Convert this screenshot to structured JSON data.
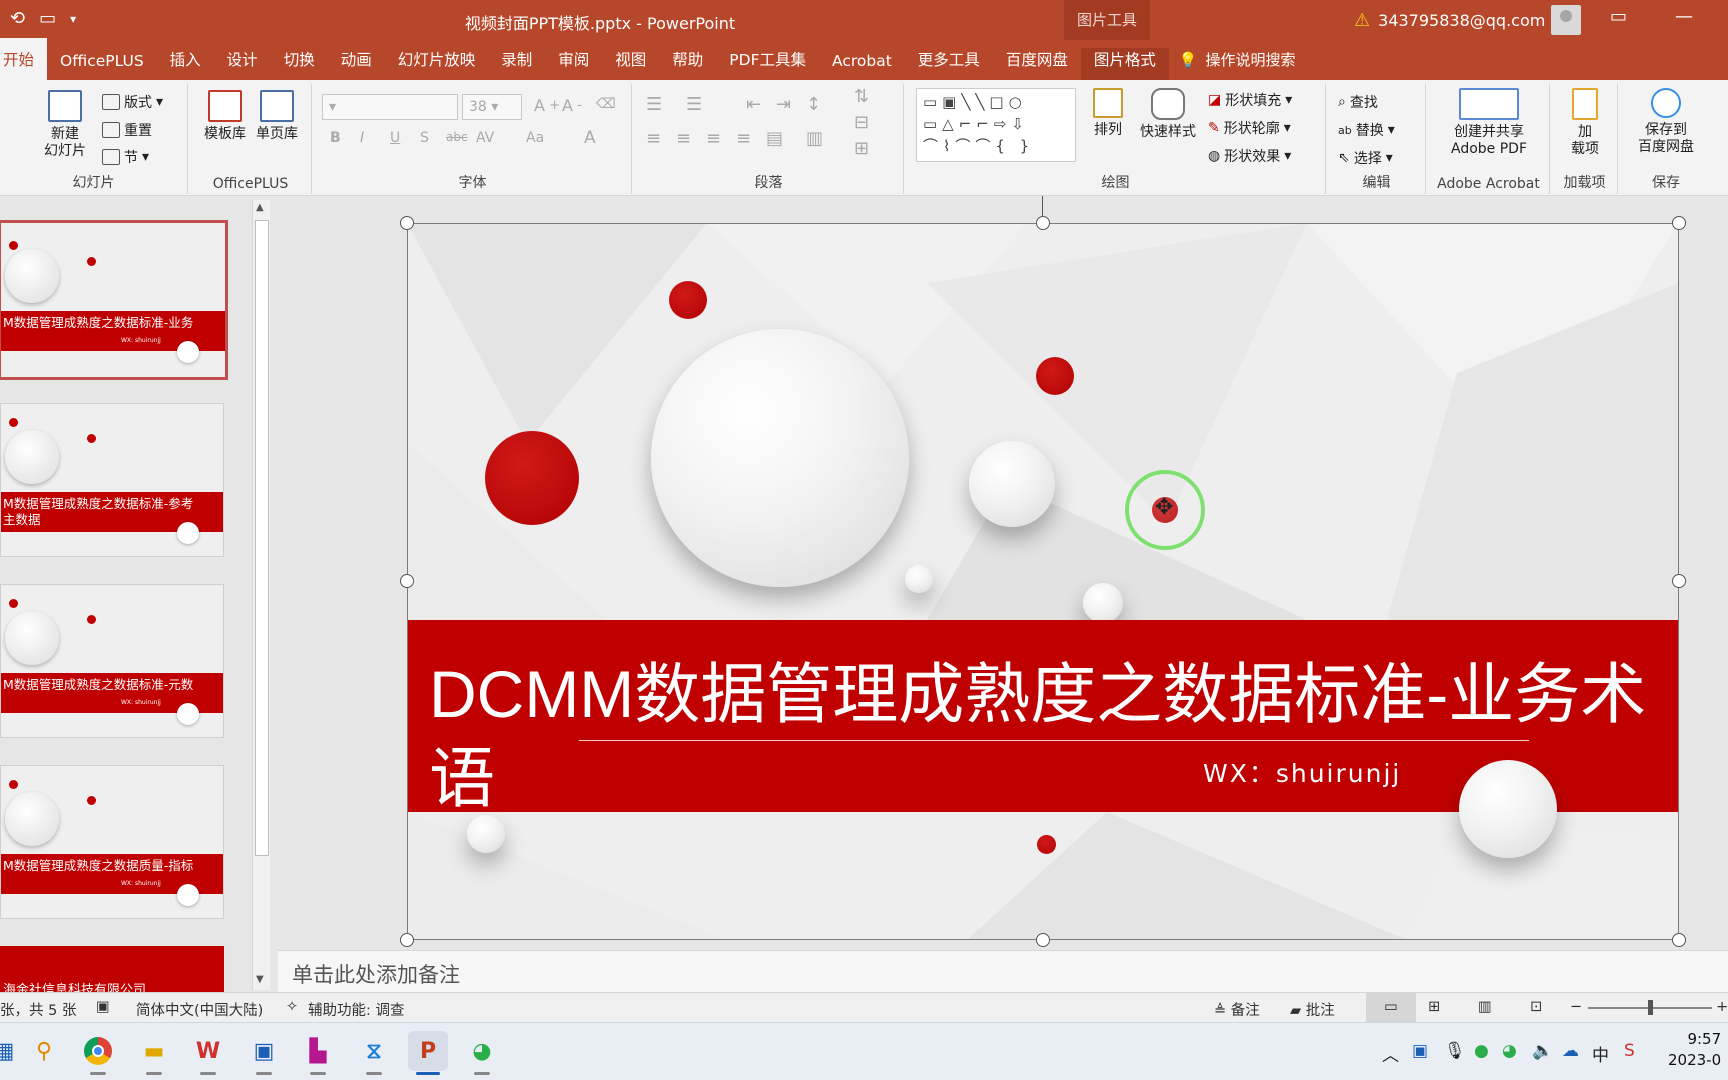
{
  "titlebar": {
    "doc_title": "视频封面PPT模板.pptx  -  PowerPoint",
    "context_tools": "图片工具",
    "account": "343795838@qq.com",
    "warning_icon": "warning-icon"
  },
  "tabs": [
    "开始",
    "OfficePLUS",
    "插入",
    "设计",
    "切换",
    "动画",
    "幻灯片放映",
    "录制",
    "审阅",
    "视图",
    "帮助",
    "PDF工具集",
    "Acrobat",
    "更多工具",
    "百度网盘",
    "图片格式"
  ],
  "tab_search": "操作说明搜索",
  "ribbon": {
    "slides": {
      "new_slide": "新建\n幻灯片",
      "layout": "版式",
      "reset": "重置",
      "section": "节",
      "label": "幻灯片"
    },
    "officeplus": {
      "template_lib": "模板库",
      "single_page": "单页库",
      "label": "OfficePLUS"
    },
    "font": {
      "font_size": "38",
      "label": "字体",
      "bold": "B",
      "italic": "I",
      "underline": "U",
      "shadow": "S",
      "strike": "abc",
      "spacing": "AV",
      "case": "Aa",
      "color": "A"
    },
    "paragraph": {
      "label": "段落"
    },
    "drawing": {
      "arrange": "排列",
      "quick_styles": "快速样式",
      "shape_fill": "形状填充",
      "shape_outline": "形状轮廓",
      "shape_effects": "形状效果",
      "label": "绘图"
    },
    "editing": {
      "find": "查找",
      "replace": "替换",
      "select": "选择",
      "label": "编辑"
    },
    "adobe": {
      "create_share": "创建并共享\nAdobe PDF",
      "label": "Adobe Acrobat"
    },
    "addins": {
      "addin": "加\n载项",
      "label": "加载项"
    },
    "save": {
      "save_baidu": "保存到\n百度网盘",
      "label": "保存"
    }
  },
  "thumbnails": [
    {
      "title": "M数据管理成熟度之数据标准-业务",
      "selected": true
    },
    {
      "title": "M数据管理成熟度之数据标准-参考\n主数据",
      "selected": false
    },
    {
      "title": "M数据管理成熟度之数据标准-元数",
      "selected": false
    },
    {
      "title": "M数据管理成熟度之数据质量-指标",
      "selected": false
    },
    {
      "title": "海金社信息科技有限公司",
      "selected": false
    }
  ],
  "thumb_wx": "WX: shuirunjj",
  "slide": {
    "title": "DCMM数据管理成熟度之数据标准-业务术语",
    "wx": "WX：shuirunjj",
    "accent": "#c00000"
  },
  "notes_placeholder": "单击此处添加备注",
  "status": {
    "slide_count": "张，共 5 张",
    "language": "简体中文(中国大陆)",
    "accessibility": "辅助功能: 调查",
    "notes": "备注",
    "comments": "批注"
  },
  "clock": {
    "time": "9:57",
    "date": "2023-0"
  }
}
